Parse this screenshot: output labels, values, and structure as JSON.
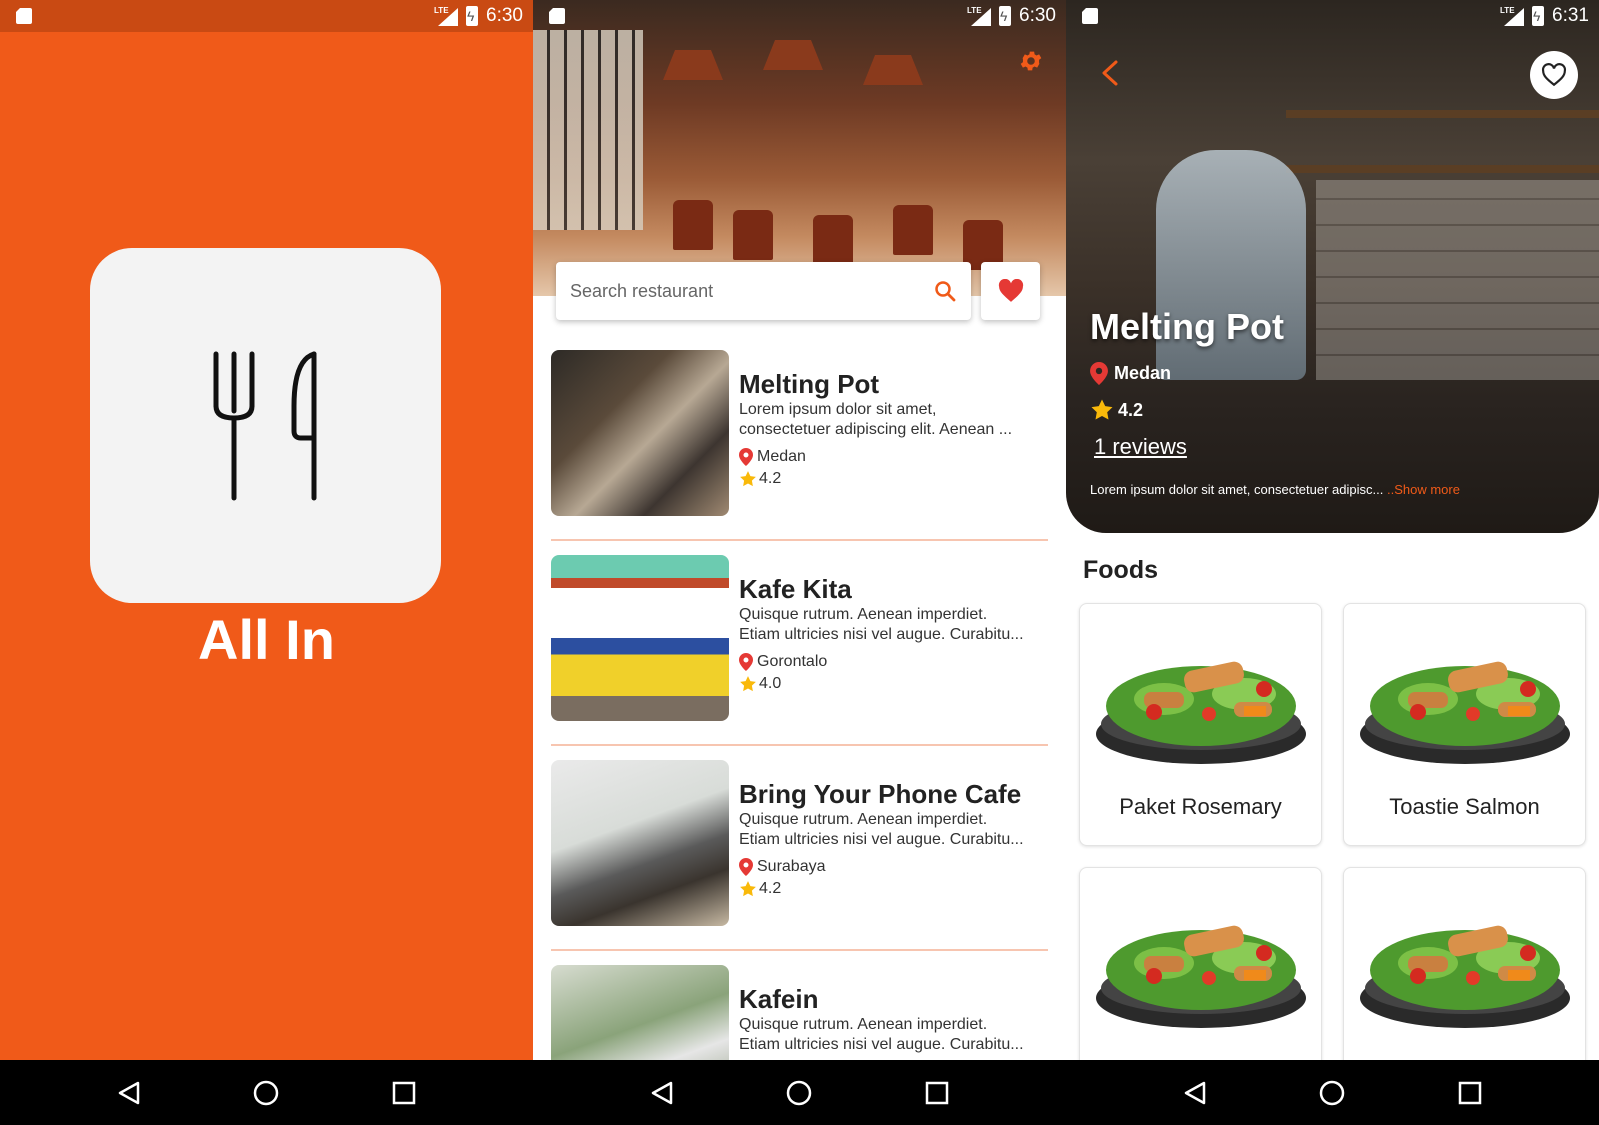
{
  "status_bars": [
    {
      "network": "LTE",
      "time": "6:30"
    },
    {
      "network": "LTE",
      "time": "6:30"
    },
    {
      "network": "LTE",
      "time": "6:31"
    }
  ],
  "splash": {
    "app_name": "All In",
    "background": "#f05a19"
  },
  "home": {
    "search": {
      "placeholder": "Search restaurant"
    },
    "restaurants": [
      {
        "name": "Melting Pot",
        "description": "Lorem ipsum dolor sit amet, consectetuer adipiscing elit. Aenean ...",
        "city": "Medan",
        "rating": "4.2"
      },
      {
        "name": "Kafe Kita",
        "description": "Quisque rutrum. Aenean imperdiet. Etiam ultricies nisi vel augue. Curabitu...",
        "city": "Gorontalo",
        "rating": "4.0"
      },
      {
        "name": "Bring Your Phone Cafe",
        "description": "Quisque rutrum. Aenean imperdiet. Etiam ultricies nisi vel augue. Curabitu...",
        "city": "Surabaya",
        "rating": "4.2"
      },
      {
        "name": "Kafein",
        "description": "Quisque rutrum. Aenean imperdiet. Etiam ultricies nisi vel augue. Curabitu...",
        "city": "",
        "rating": ""
      }
    ]
  },
  "detail": {
    "name": "Melting Pot",
    "city": "Medan",
    "rating": "4.2",
    "reviews": "1 reviews",
    "description": "Lorem ipsum dolor sit amet, consectetuer adipisc... ",
    "show_more": "..Show more",
    "foods_heading": "Foods",
    "foods": [
      {
        "name": "Paket Rosemary"
      },
      {
        "name": "Toastie Salmon"
      },
      {
        "name": ""
      },
      {
        "name": ""
      }
    ]
  },
  "colors": {
    "accent": "#f05a19",
    "pin": "#e53935",
    "star": "#f9b90a",
    "heart": "#e53935"
  }
}
